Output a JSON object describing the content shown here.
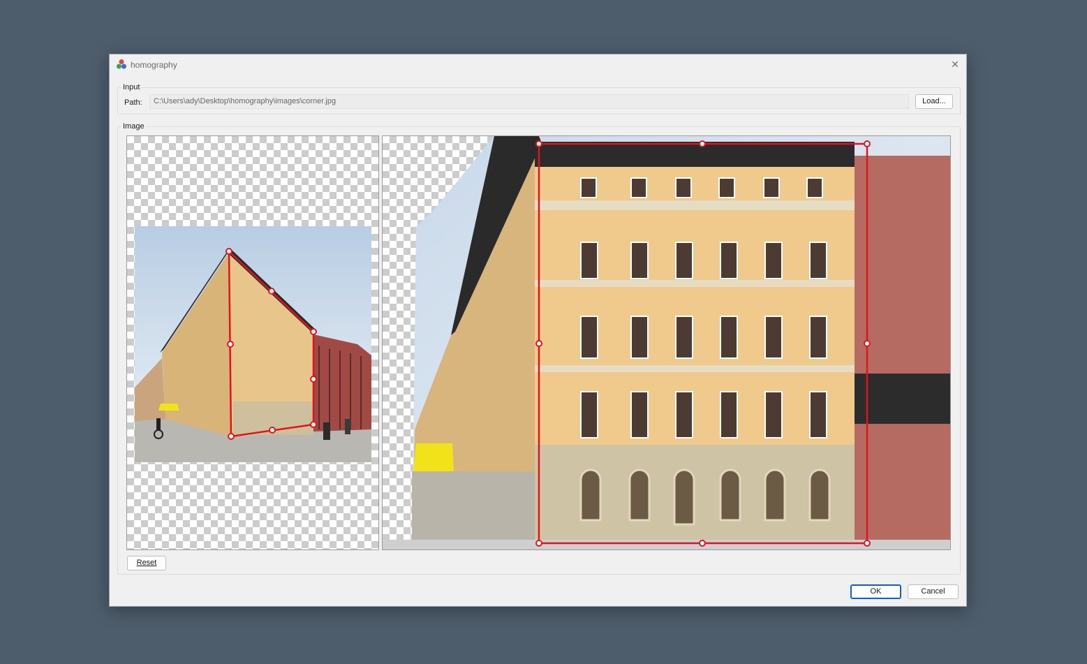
{
  "window": {
    "title": "homography",
    "icon": "homography-app-icon",
    "close_icon": "close-icon"
  },
  "input": {
    "legend": "Input",
    "path_label": "Path:",
    "path_value": "C:\\Users\\ady\\Desktop\\homography\\images\\corner.jpg",
    "load_label": "Load..."
  },
  "image": {
    "legend": "Image",
    "reset_label": "Reset"
  },
  "buttons": {
    "ok_label": "OK",
    "cancel_label": "Cancel"
  },
  "colors": {
    "handle": "#e0141c",
    "desktop": "#4e5d6c",
    "facade": "#e8c58a",
    "sky": "#d7e3ef",
    "accent": "#0b63c9"
  }
}
